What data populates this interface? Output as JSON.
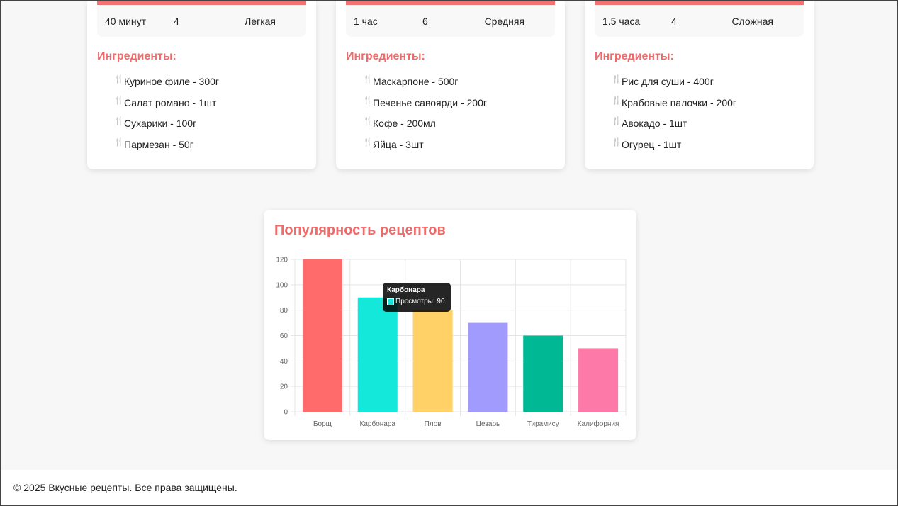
{
  "recipes": [
    {
      "time": "40 минут",
      "servings": "4",
      "difficulty": "Легкая",
      "ingredients_title": "Ингредиенты:",
      "ingredients": [
        "Куриное филе - 300г",
        "Салат романо - 1шт",
        "Сухарики - 100г",
        "Пармезан - 50г"
      ]
    },
    {
      "time": "1 час",
      "servings": "6",
      "difficulty": "Средняя",
      "ingredients_title": "Ингредиенты:",
      "ingredients": [
        "Маскарпоне - 500г",
        "Печенье савоярди - 200г",
        "Кофе - 200мл",
        "Яйца - 3шт"
      ]
    },
    {
      "time": "1.5 часа",
      "servings": "4",
      "difficulty": "Сложная",
      "ingredients_title": "Ингредиенты:",
      "ingredients": [
        "Рис для суши - 400г",
        "Крабовые палочки - 200г",
        "Авокадо - 1шт",
        "Огурец - 1шт"
      ]
    }
  ],
  "ingredient_icon": "fork-knife-icon",
  "chart_section": {
    "title": "Популярность рецептов",
    "tooltip": {
      "title": "Карбонара",
      "label": "Просмотры: 90"
    }
  },
  "chart_data": {
    "type": "bar",
    "title": "Популярность рецептов",
    "categories": [
      "Борщ",
      "Карбонара",
      "Плов",
      "Цезарь",
      "Тирамису",
      "Калифорния"
    ],
    "series": [
      {
        "name": "Просмотры",
        "values": [
          120,
          90,
          80,
          70,
          60,
          50
        ]
      }
    ],
    "colors": [
      "#ff6b6b",
      "#14e8da",
      "#ffd166",
      "#a29bfe",
      "#00b894",
      "#fd79a8"
    ],
    "ylim": [
      0,
      120
    ],
    "yticks": [
      0,
      20,
      40,
      60,
      80,
      100,
      120
    ],
    "grid": true,
    "legend": "none"
  },
  "footer": {
    "text": "© 2025 Вкусные рецепты. Все права защищены."
  }
}
